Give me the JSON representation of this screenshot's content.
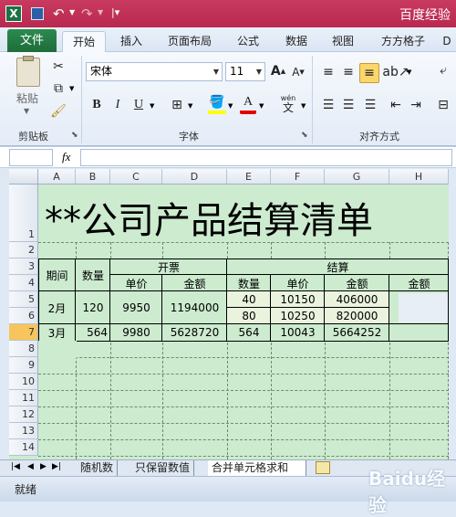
{
  "title": {
    "text": "百度经验"
  },
  "tabs": [
    {
      "label": "文件"
    },
    {
      "label": "开始"
    },
    {
      "label": "插入"
    },
    {
      "label": "页面布局"
    },
    {
      "label": "公式"
    },
    {
      "label": "数据"
    },
    {
      "label": "视图"
    },
    {
      "label": "方方格子"
    },
    {
      "label": "D"
    }
  ],
  "ribbon": {
    "clipboard": {
      "paste_label": "粘贴",
      "group_label": "剪贴板"
    },
    "font": {
      "name": "宋体",
      "size": "11",
      "group_label": "字体",
      "bold": "B",
      "italic": "I",
      "underline": "U",
      "font_color": "A",
      "phonetic": "wén",
      "grow": "A",
      "shrink": "A"
    },
    "alignment": {
      "group_label": "对齐方式"
    }
  },
  "formula_bar": {
    "fx": "fx",
    "name_box": "",
    "value": ""
  },
  "columns": [
    "A",
    "B",
    "C",
    "D",
    "E",
    "F",
    "G",
    "H"
  ],
  "rows": [
    "1",
    "2",
    "3",
    "4",
    "5",
    "6",
    "7",
    "8",
    "9",
    "10",
    "11",
    "12",
    "13",
    "14"
  ],
  "table": {
    "title": "**公司产品结算清单",
    "h_period": "期间",
    "h_qty": "数量",
    "h_invoice": "开票",
    "h_unit_price": "单价",
    "h_amount": "金额",
    "h_settle": "结算",
    "h_settle_qty": "数量",
    "h_settle_price": "单价",
    "h_settle_amount": "金额",
    "h_extra_amount": "金额",
    "r_feb_period": "2月",
    "r_feb_qty": "120",
    "r_feb_price": "9950",
    "r_feb_amount": "1194000",
    "r_feb_s1_qty": "40",
    "r_feb_s1_price": "10150",
    "r_feb_s1_amount": "406000",
    "r_feb_s2_qty": "80",
    "r_feb_s2_price": "10250",
    "r_feb_s2_amount": "820000",
    "r_mar_period": "3月",
    "r_mar_qty": "564",
    "r_mar_price": "9980",
    "r_mar_amount": "5628720",
    "r_mar_s_qty": "564",
    "r_mar_s_price": "10043",
    "r_mar_s_amount": "5664252"
  },
  "sheets": [
    {
      "label": "随机数"
    },
    {
      "label": "只保留数值"
    },
    {
      "label": "合并单元格求和"
    }
  ],
  "status": {
    "ready": "就绪"
  },
  "watermark": "Baidu经验"
}
